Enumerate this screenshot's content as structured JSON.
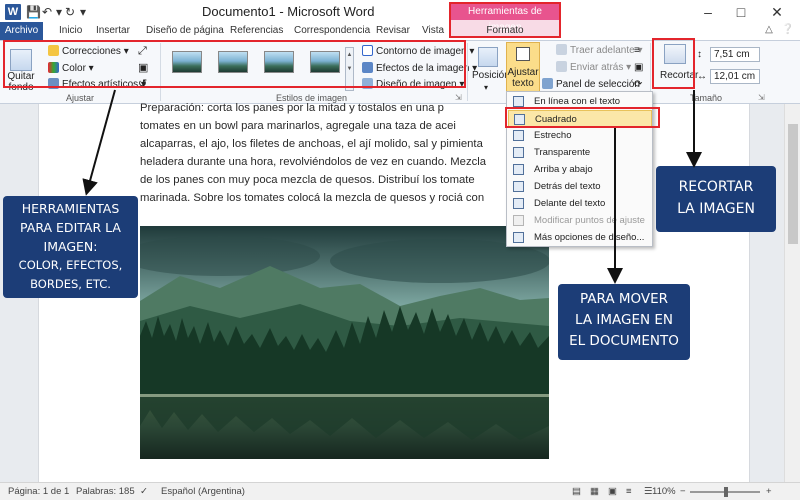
{
  "window": {
    "title": "Documento1 - Microsoft Word",
    "app_icon": "W",
    "qat_icons": [
      "save-icon",
      "undo-icon",
      "redo-icon",
      "customize-icon"
    ]
  },
  "context_tab": {
    "title": "Herramientas de imagen",
    "tab": "Formato"
  },
  "tabs": [
    "Archivo",
    "Inicio",
    "Insertar",
    "Diseño de página",
    "Referencias",
    "Correspondencia",
    "Revisar",
    "Vista"
  ],
  "ribbon": {
    "ajustar": {
      "label": "Ajustar",
      "quitar_fondo": "Quitar fondo",
      "correcciones": "Correcciones",
      "color": "Color",
      "efectos_artisticos": "Efectos artísticos"
    },
    "estilos": {
      "label": "Estilos de imagen",
      "contorno": "Contorno de imagen",
      "efectos": "Efectos de la imagen",
      "diseno": "Diseño de imagen"
    },
    "organizar": {
      "posicion": "Posición",
      "ajustar_texto": "Ajustar texto",
      "traer_adelante": "Traer adelante",
      "enviar_atras": "Enviar atrás",
      "panel_seleccion": "Panel de selección"
    },
    "tamano": {
      "label": "Tamaño",
      "recortar": "Recortar",
      "height": "7,51 cm",
      "width": "12,01 cm"
    }
  },
  "document": {
    "lines": [
      "Preparación: corta los panes por la mitad y tostalos en una p",
      "tomates en un bowl para marinarlos, agregale una taza de acei",
      "alcaparras, el ajo, los filetes de anchoas, el ají molido, sal y pimienta",
      "heladera durante una hora, revolviéndolos de vez en cuando. Mezcla",
      "de los panes con muy poca mezcla de quesos. Distribuí los tomate",
      "marinada. Sobre los tomates colocá la mezcla de quesos y rociá con"
    ]
  },
  "wrap_menu": {
    "items": [
      {
        "label": "En línea con el texto",
        "icon": "inline-wrap-icon",
        "state": "normal"
      },
      {
        "label": "Cuadrado",
        "icon": "square-wrap-icon",
        "state": "highlighted"
      },
      {
        "label": "Estrecho",
        "icon": "tight-wrap-icon",
        "state": "normal"
      },
      {
        "label": "Transparente",
        "icon": "through-wrap-icon",
        "state": "normal"
      },
      {
        "label": "Arriba y abajo",
        "icon": "top-bottom-wrap-icon",
        "state": "normal"
      },
      {
        "label": "Detrás del texto",
        "icon": "behind-text-icon",
        "state": "normal"
      },
      {
        "label": "Delante del texto",
        "icon": "front-text-icon",
        "state": "normal"
      },
      {
        "label": "Modificar puntos de ajuste",
        "icon": "edit-wrap-points-icon",
        "state": "disabled"
      },
      {
        "label": "Más opciones de diseño...",
        "icon": "layout-options-icon",
        "state": "normal"
      }
    ]
  },
  "callouts": {
    "herramientas": [
      "HERRAMIENTAS",
      "PARA EDITAR LA",
      "IMAGEN:",
      "COLOR, EFECTOS,",
      "BORDES, ETC."
    ],
    "recortar": [
      "RECORTAR",
      "LA IMAGEN"
    ],
    "mover": [
      "PARA MOVER",
      "LA IMAGEN EN",
      "EL DOCUMENTO"
    ]
  },
  "status": {
    "page": "Página: 1 de 1",
    "words": "Palabras: 185",
    "language": "Español (Argentina)",
    "zoom": "110%"
  },
  "colors": {
    "word_blue": "#2b579a",
    "callout_navy": "#1c3d77",
    "highlight_red": "#e3252c",
    "context_pink": "#e8548e"
  }
}
